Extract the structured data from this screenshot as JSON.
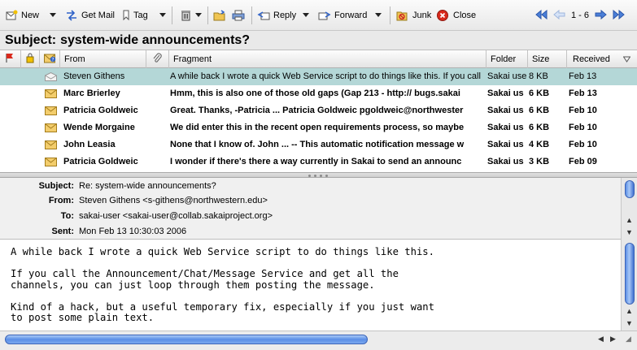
{
  "toolbar": {
    "new_label": "New",
    "get_mail_label": "Get Mail",
    "tag_label": "Tag",
    "reply_label": "Reply",
    "forward_label": "Forward",
    "junk_label": "Junk",
    "close_label": "Close",
    "counter": "1 - 6"
  },
  "subject_bar": {
    "label": "Subject:",
    "value": "system-wide announcements?"
  },
  "columns": {
    "from": "From",
    "fragment": "Fragment",
    "folder": "Folder",
    "size": "Size",
    "received": "Received"
  },
  "messages": [
    {
      "from": "Steven Githens",
      "fragment": "A while back I wrote a quick Web Service script to do things like this. If you call",
      "folder": "Sakai user",
      "size": "8 KB",
      "received": "Feb 13",
      "unread": false,
      "selected": true
    },
    {
      "from": "Marc Brierley",
      "fragment": "Hmm, this is also one of those old gaps (Gap 213 - http:// bugs.sakai",
      "folder": "Sakai us",
      "size": "6 KB",
      "received": "Feb 13",
      "unread": true,
      "selected": false
    },
    {
      "from": "Patricia Goldweic",
      "fragment": "Great. Thanks, -Patricia ... Patricia Goldweic pgoldweic@northwester",
      "folder": "Sakai us",
      "size": "6 KB",
      "received": "Feb 10",
      "unread": true,
      "selected": false
    },
    {
      "from": "Wende Morgaine",
      "fragment": "We did enter this in the recent open requirements process, so maybe",
      "folder": "Sakai us",
      "size": "6 KB",
      "received": "Feb 10",
      "unread": true,
      "selected": false
    },
    {
      "from": "John Leasia",
      "fragment": "None that I know of. John ... -- This automatic notification message w",
      "folder": "Sakai us",
      "size": "4 KB",
      "received": "Feb 10",
      "unread": true,
      "selected": false
    },
    {
      "from": "Patricia Goldweic",
      "fragment": "I wonder if there's there a way currently in Sakai to send an announc",
      "folder": "Sakai us",
      "size": "3 KB",
      "received": "Feb 09",
      "unread": true,
      "selected": false
    }
  ],
  "headers": {
    "subject_key": "Subject:",
    "subject": "Re: system-wide announcements?",
    "from_key": "From:",
    "from": "Steven Githens <s-githens@northwestern.edu>",
    "to_key": "To:",
    "to": "sakai-user <sakai-user@collab.sakaiproject.org>",
    "sent_key": "Sent:",
    "sent": "Mon Feb 13 10:30:03 2006"
  },
  "body_text": "A while back I wrote a quick Web Service script to do things like this.\n\nIf you call the Announcement/Chat/Message Service and get all the\nchannels, you can just loop through them posting the message.\n\nKind of a hack, but a useful temporary fix, especially if you just want\nto post some plain text.",
  "colors": {
    "selected_row": "#b4d7d7",
    "scroll_accent": "#5b8ee6",
    "close_red": "#d9291c",
    "envelope": "#e8b84a",
    "nav_arrow": "#4a7fd8"
  }
}
